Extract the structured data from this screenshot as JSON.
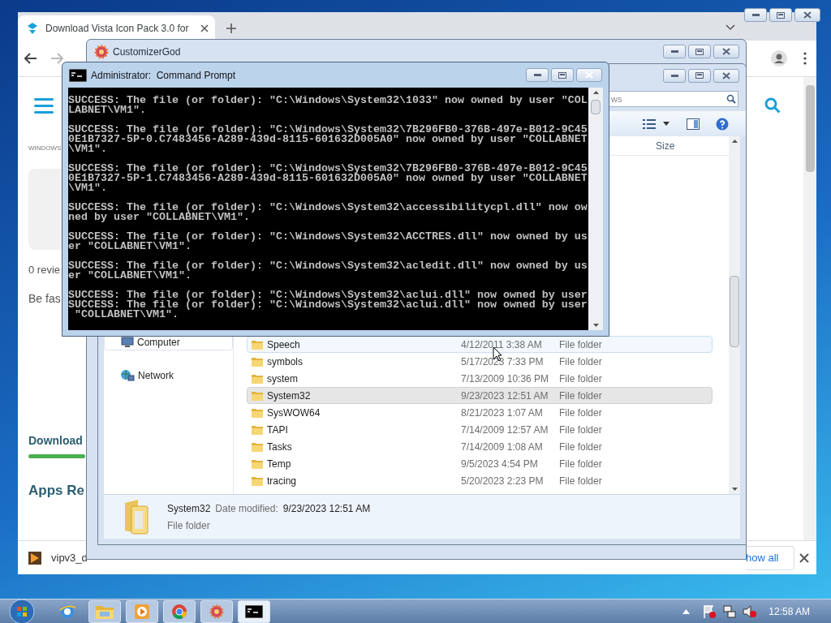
{
  "browser": {
    "tab": {
      "title": "Download Vista Icon Pack 3.0 for"
    },
    "page": {
      "category": "WINDOWS",
      "reviews": "0 revie",
      "prompt": "Be fas",
      "download_heading": "Download",
      "apps_heading": "Apps Re"
    },
    "download_bar": {
      "file": "vipv3_d",
      "show_all": "how all"
    }
  },
  "customizer": {
    "title": "CustomizerGod"
  },
  "explorer": {
    "search_value": "ws",
    "size_column": "Size",
    "nav_items": [
      {
        "label": "Computer",
        "kind": "computer"
      },
      {
        "label": "Network",
        "kind": "network"
      }
    ],
    "files": [
      {
        "name": "Speech",
        "date": "4/12/2011 3:38 AM",
        "type": "File folder",
        "selected": false,
        "hovered": true
      },
      {
        "name": "symbols",
        "date": "5/17/2023 7:33 PM",
        "type": "File folder",
        "selected": false,
        "hovered": false
      },
      {
        "name": "system",
        "date": "7/13/2009 10:36 PM",
        "type": "File folder",
        "selected": false,
        "hovered": false
      },
      {
        "name": "System32",
        "date": "9/23/2023 12:51 AM",
        "type": "File folder",
        "selected": true,
        "hovered": false
      },
      {
        "name": "SysWOW64",
        "date": "8/21/2023 1:07 AM",
        "type": "File folder",
        "selected": false,
        "hovered": false
      },
      {
        "name": "TAPI",
        "date": "7/14/2009 12:57 AM",
        "type": "File folder",
        "selected": false,
        "hovered": false
      },
      {
        "name": "Tasks",
        "date": "7/14/2009 1:08 AM",
        "type": "File folder",
        "selected": false,
        "hovered": false
      },
      {
        "name": "Temp",
        "date": "9/5/2023 4:54 PM",
        "type": "File folder",
        "selected": false,
        "hovered": false
      },
      {
        "name": "tracing",
        "date": "5/20/2023 2:23 PM",
        "type": "File folder",
        "selected": false,
        "hovered": false
      }
    ],
    "details": {
      "name": "System32",
      "date_label": "Date modified:",
      "date": "9/23/2023 12:51 AM",
      "type": "File folder"
    }
  },
  "console": {
    "title": "Administrator:  Command Prompt",
    "entries": [
      {
        "lines": [
          "SUCCESS: The file (or folder): \"C:\\Windows\\System32\\1033\" now owned by user \"COL",
          "LABNET\\VM1\"."
        ]
      },
      {
        "lines": [
          "SUCCESS: The file (or folder): \"C:\\Windows\\System32\\7B296FB0-376B-497e-B012-9C45",
          "0E1B7327-5P-0.C7483456-A289-439d-8115-601632D005A0\" now owned by user \"COLLABNET",
          "\\VM1\"."
        ]
      },
      {
        "lines": [
          "SUCCESS: The file (or folder): \"C:\\Windows\\System32\\7B296FB0-376B-497e-B012-9C45",
          "0E1B7327-5P-1.C7483456-A289-439d-8115-601632D005A0\" now owned by user \"COLLABNET",
          "\\VM1\"."
        ]
      },
      {
        "lines": [
          "SUCCESS: The file (or folder): \"C:\\Windows\\System32\\accessibilitycpl.dll\" now ow",
          "ned by user \"COLLABNET\\VM1\"."
        ]
      },
      {
        "lines": [
          "SUCCESS: The file (or folder): \"C:\\Windows\\System32\\ACCTRES.dll\" now owned by us",
          "er \"COLLABNET\\VM1\"."
        ]
      },
      {
        "lines": [
          "SUCCESS: The file (or folder): \"C:\\Windows\\System32\\acledit.dll\" now owned by us",
          "er \"COLLABNET\\VM1\"."
        ]
      },
      {
        "lines": [
          "SUCCESS: The file (or folder): \"C:\\Windows\\System32\\aclui.dll\" now owned by user",
          "SUCCESS: The file (or folder): \"C:\\Windows\\System32\\aclui.dll\" now owned by user",
          " \"COLLABNET\\VM1\"."
        ]
      }
    ]
  },
  "taskbar": {
    "apps": [
      {
        "kind": "ie",
        "running": false,
        "selected": false
      },
      {
        "kind": "explorer",
        "running": true,
        "selected": false
      },
      {
        "kind": "media",
        "running": true,
        "selected": false
      },
      {
        "kind": "chrome",
        "running": true,
        "selected": false
      },
      {
        "kind": "gear",
        "running": true,
        "selected": false
      },
      {
        "kind": "console",
        "running": true,
        "selected": true
      }
    ],
    "clock": "12:58 AM"
  }
}
